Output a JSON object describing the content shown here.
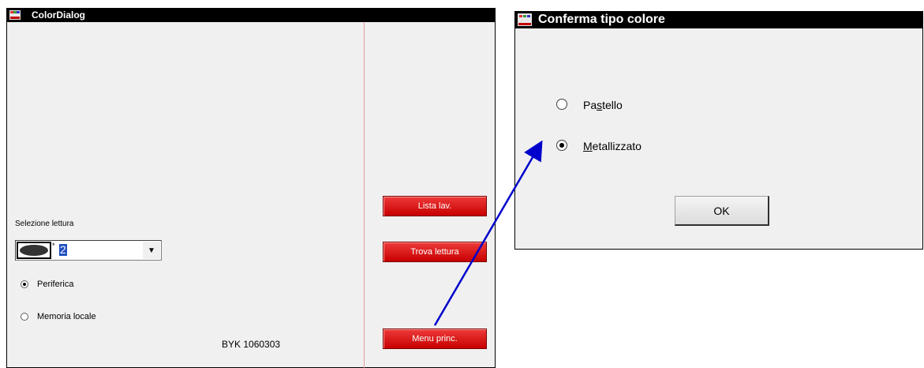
{
  "color_dialog": {
    "title": "ColorDialog",
    "selection_label": "Selezione lettura",
    "combo_value": "2",
    "combo_asterisk": "*",
    "radio_peripheral": "Periferica",
    "radio_local_memory": "Memoria locale",
    "device_id": "BYK 1060303",
    "btn_worklist": "Lista lav.",
    "btn_find_reading": "Trova lettura",
    "btn_main_menu": "Menu princ.",
    "selected_radio": "Periferica"
  },
  "confirm_dialog": {
    "title": "Conferma tipo colore",
    "option_pastel": {
      "before": "Pa",
      "underlined": "s",
      "after": "tello"
    },
    "option_metallic": {
      "before": "",
      "underlined": "M",
      "after": "etallizzato"
    },
    "selected_option": "Metallizzato",
    "ok_label": "OK"
  },
  "colors": {
    "button_red": "#e01010",
    "title_bar": "#000000",
    "arrow_blue": "#0000cc",
    "selection_blue": "#1f4fbf"
  }
}
